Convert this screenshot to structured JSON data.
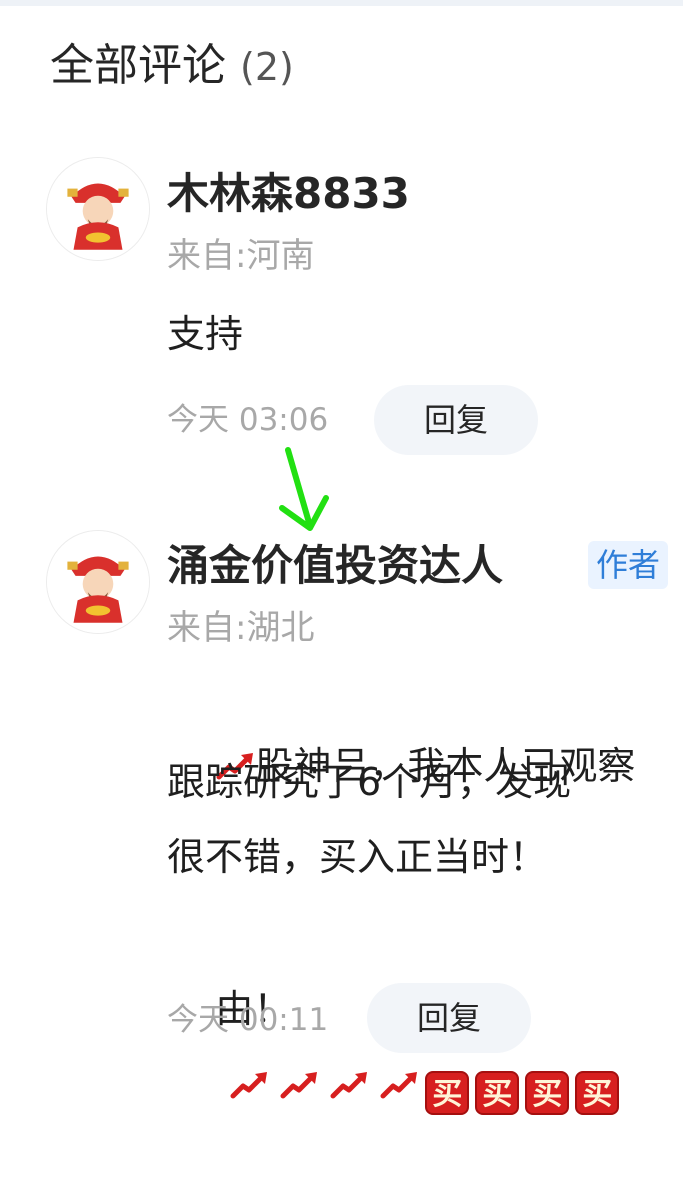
{
  "header": {
    "title": "全部评论",
    "count": "(2)"
  },
  "comments": [
    {
      "author": "木林森8833",
      "location": "来自:河南",
      "text_lines": [
        "支持"
      ],
      "time": "今天 03:06",
      "reply_label": "回复"
    },
    {
      "author": "涌金价值投资达人",
      "badge": "作者",
      "location": "来自:湖北",
      "text_lines": [
        "股神吕，我本人已观察",
        "跟踪研究了6个月，发现",
        "很不错，买入正当时！",
        "由！"
      ],
      "sticker_text": "买",
      "time": "今天 00:11",
      "reply_label": "回复"
    }
  ],
  "colors": {
    "accent_blue": "#2f7ed8",
    "arrow_green": "#22e012",
    "sticker_red": "#d71f1f"
  },
  "icons": [
    "caishen-avatar-icon",
    "trend-up-icon",
    "buy-sticker-icon",
    "arrow-down-annotation"
  ]
}
